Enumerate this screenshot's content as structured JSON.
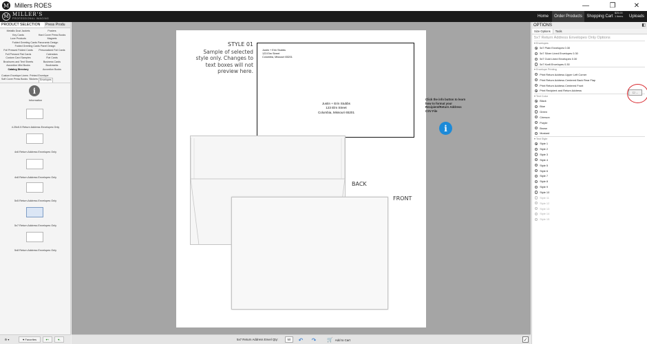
{
  "app": {
    "title": "Millers ROES",
    "logo_glyph": "M"
  },
  "window_controls": {
    "minimize": "—",
    "restore": "❐",
    "close": "✕"
  },
  "navbar": {
    "brand_main": "MILLER'S",
    "brand_sub": "PROFESSIONAL IMAGING",
    "items": [
      "Home",
      "Order Products",
      "Shopping Cart",
      "Uploads"
    ],
    "active": "Order Products",
    "cart_total_line1": "$25.00",
    "cart_total_line2": "1 items"
  },
  "left_panel": {
    "tabs": [
      "PRODUCT SELECTION",
      "Press Produ"
    ],
    "categories": [
      "Metallic Dust Jackets",
      "Posters",
      "Key Cards",
      "Hard Cover Press Books",
      "Luxe Products",
      "Magnets",
      "Folded Greeting Cards Panoramic Design",
      "",
      "Folded Greeting Cards Panel Design",
      "",
      "Foil Pressed Folded Cards",
      "",
      "Personalized Foil Cards",
      "Foil Pressed Flat Cards",
      "Calendars",
      "Custom Card Samples",
      "Flat Cards",
      "Brochures and Tent Sheets",
      "Business Cards",
      "Accordion Mini Books",
      "Bookmarks",
      "Catalog Directory",
      "Accordion Books",
      ""
    ],
    "subtabs": [
      "Custom Envelope Liners",
      "Printed Envelope",
      "Soft Cover Press Books",
      "Stickers",
      "Envelopes"
    ],
    "active_subtab": "Envelopes",
    "products": [
      {
        "label": "Information",
        "type": "info"
      },
      {
        "label": "4.25x5.5 Return Address Envelopes Only",
        "type": "thumb"
      },
      {
        "label": "4x6 Return Address Envelopes Only",
        "type": "thumb"
      },
      {
        "label": "4x8 Return Address Envelopes Only",
        "type": "thumb"
      },
      {
        "label": "5x5 Return Address Envelopes Only",
        "type": "thumb"
      },
      {
        "label": "5x7 Return Address Envelopes Only",
        "type": "thumb",
        "selected": true
      },
      {
        "label": "5x8 Return Address Envelopes Only",
        "type": "thumb"
      }
    ],
    "footer": {
      "settings": "⚙ ▾",
      "favorites": "♥ Favorites",
      "fav_add": "♥+",
      "fav_remove": "♥-"
    }
  },
  "preview": {
    "style_heading": "STYLE 01",
    "style_note": "Sample of selected style only. Changes to text boxes will not preview here.",
    "return_address": [
      "Justin + Erin Stubbs",
      "123 Elm Street",
      "Columbia, Missouri 65201"
    ],
    "recipient_address": [
      "Justin + Erin Stubbs",
      "123 Elm Street",
      "Columbia, Missouri 65201"
    ],
    "back_label": "BACK",
    "front_label": "FRONT",
    "csv_note": "Click the info button to learn how to format your Recipient/Return Address CSV File",
    "info_glyph": "i"
  },
  "bottom_bar": {
    "qty_label": "5x7 Return Address Envel Qty:",
    "qty_value": "50",
    "undo_icon": "↶",
    "redo_icon": "↷",
    "add_to_cart": "Add to Cart",
    "check": "✓"
  },
  "right_panel": {
    "header": "OPTIONS",
    "pin": "◧",
    "tabs": [
      "Size Options",
      "Tools"
    ],
    "product_title": "5x7 Return Address Envelopes Only Options",
    "groups": [
      {
        "name": "Envelopes",
        "options": [
          {
            "label": "5x7 Plain Envelopes 0.30",
            "checked": true
          },
          {
            "label": "5x7 Silver Lined Envelopes 0.30"
          },
          {
            "label": "5x7 Gold Lined Envelopes 0.30"
          },
          {
            "label": "5x7 Kraft Envelopes 0.30"
          }
        ]
      },
      {
        "name": "Envelope Printing",
        "options": [
          {
            "label": "Print Return Address Upper Left Corner"
          },
          {
            "label": "Print Return Address Centered Back Rear Flap"
          },
          {
            "label": "Print Return Address Centered Front"
          },
          {
            "label": "Print Recipient and Return Address",
            "checked": true
          }
        ]
      },
      {
        "name": "Text Color",
        "options": [
          {
            "label": "Black",
            "checked": true
          },
          {
            "label": "Blue"
          },
          {
            "label": "Green"
          },
          {
            "label": "Crimson"
          },
          {
            "label": "Purple"
          },
          {
            "label": "Brown"
          },
          {
            "label": "Mustard"
          }
        ]
      },
      {
        "name": "Text Style",
        "options": [
          {
            "label": "Style 1",
            "checked": true
          },
          {
            "label": "Style 2"
          },
          {
            "label": "Style 3"
          },
          {
            "label": "Style 4"
          },
          {
            "label": "Style 5"
          },
          {
            "label": "Style 6"
          },
          {
            "label": "Style 7"
          },
          {
            "label": "Style 8"
          },
          {
            "label": "Style 9"
          },
          {
            "label": "Style 10"
          },
          {
            "label": "Style 11",
            "disabled": true
          },
          {
            "label": "Style 12",
            "disabled": true
          },
          {
            "label": "Style 13",
            "disabled": true
          },
          {
            "label": "Style 14",
            "disabled": true
          },
          {
            "label": "Style 15",
            "disabled": true
          }
        ]
      }
    ],
    "csv_button": "☐ ...",
    "highlight_color": "#d8262c"
  },
  "colors": {
    "nav_bg": "#1b1b1b",
    "canvas_bg": "#a5a5a5",
    "info_blue": "#1c8ad8"
  }
}
